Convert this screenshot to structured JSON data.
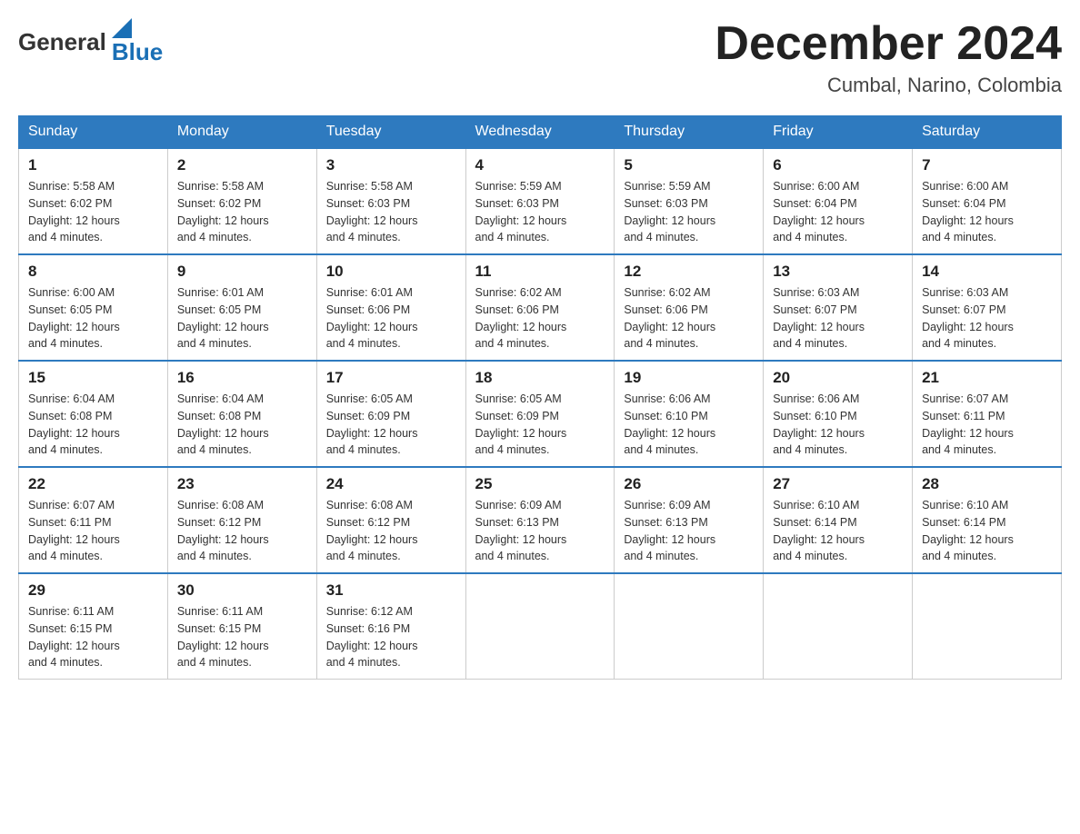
{
  "header": {
    "logo_general": "General",
    "logo_blue": "Blue",
    "month": "December 2024",
    "location": "Cumbal, Narino, Colombia"
  },
  "days_of_week": [
    "Sunday",
    "Monday",
    "Tuesday",
    "Wednesday",
    "Thursday",
    "Friday",
    "Saturday"
  ],
  "weeks": [
    [
      {
        "day": "1",
        "sunrise": "5:58 AM",
        "sunset": "6:02 PM",
        "daylight": "12 hours and 4 minutes."
      },
      {
        "day": "2",
        "sunrise": "5:58 AM",
        "sunset": "6:02 PM",
        "daylight": "12 hours and 4 minutes."
      },
      {
        "day": "3",
        "sunrise": "5:58 AM",
        "sunset": "6:03 PM",
        "daylight": "12 hours and 4 minutes."
      },
      {
        "day": "4",
        "sunrise": "5:59 AM",
        "sunset": "6:03 PM",
        "daylight": "12 hours and 4 minutes."
      },
      {
        "day": "5",
        "sunrise": "5:59 AM",
        "sunset": "6:03 PM",
        "daylight": "12 hours and 4 minutes."
      },
      {
        "day": "6",
        "sunrise": "6:00 AM",
        "sunset": "6:04 PM",
        "daylight": "12 hours and 4 minutes."
      },
      {
        "day": "7",
        "sunrise": "6:00 AM",
        "sunset": "6:04 PM",
        "daylight": "12 hours and 4 minutes."
      }
    ],
    [
      {
        "day": "8",
        "sunrise": "6:00 AM",
        "sunset": "6:05 PM",
        "daylight": "12 hours and 4 minutes."
      },
      {
        "day": "9",
        "sunrise": "6:01 AM",
        "sunset": "6:05 PM",
        "daylight": "12 hours and 4 minutes."
      },
      {
        "day": "10",
        "sunrise": "6:01 AM",
        "sunset": "6:06 PM",
        "daylight": "12 hours and 4 minutes."
      },
      {
        "day": "11",
        "sunrise": "6:02 AM",
        "sunset": "6:06 PM",
        "daylight": "12 hours and 4 minutes."
      },
      {
        "day": "12",
        "sunrise": "6:02 AM",
        "sunset": "6:06 PM",
        "daylight": "12 hours and 4 minutes."
      },
      {
        "day": "13",
        "sunrise": "6:03 AM",
        "sunset": "6:07 PM",
        "daylight": "12 hours and 4 minutes."
      },
      {
        "day": "14",
        "sunrise": "6:03 AM",
        "sunset": "6:07 PM",
        "daylight": "12 hours and 4 minutes."
      }
    ],
    [
      {
        "day": "15",
        "sunrise": "6:04 AM",
        "sunset": "6:08 PM",
        "daylight": "12 hours and 4 minutes."
      },
      {
        "day": "16",
        "sunrise": "6:04 AM",
        "sunset": "6:08 PM",
        "daylight": "12 hours and 4 minutes."
      },
      {
        "day": "17",
        "sunrise": "6:05 AM",
        "sunset": "6:09 PM",
        "daylight": "12 hours and 4 minutes."
      },
      {
        "day": "18",
        "sunrise": "6:05 AM",
        "sunset": "6:09 PM",
        "daylight": "12 hours and 4 minutes."
      },
      {
        "day": "19",
        "sunrise": "6:06 AM",
        "sunset": "6:10 PM",
        "daylight": "12 hours and 4 minutes."
      },
      {
        "day": "20",
        "sunrise": "6:06 AM",
        "sunset": "6:10 PM",
        "daylight": "12 hours and 4 minutes."
      },
      {
        "day": "21",
        "sunrise": "6:07 AM",
        "sunset": "6:11 PM",
        "daylight": "12 hours and 4 minutes."
      }
    ],
    [
      {
        "day": "22",
        "sunrise": "6:07 AM",
        "sunset": "6:11 PM",
        "daylight": "12 hours and 4 minutes."
      },
      {
        "day": "23",
        "sunrise": "6:08 AM",
        "sunset": "6:12 PM",
        "daylight": "12 hours and 4 minutes."
      },
      {
        "day": "24",
        "sunrise": "6:08 AM",
        "sunset": "6:12 PM",
        "daylight": "12 hours and 4 minutes."
      },
      {
        "day": "25",
        "sunrise": "6:09 AM",
        "sunset": "6:13 PM",
        "daylight": "12 hours and 4 minutes."
      },
      {
        "day": "26",
        "sunrise": "6:09 AM",
        "sunset": "6:13 PM",
        "daylight": "12 hours and 4 minutes."
      },
      {
        "day": "27",
        "sunrise": "6:10 AM",
        "sunset": "6:14 PM",
        "daylight": "12 hours and 4 minutes."
      },
      {
        "day": "28",
        "sunrise": "6:10 AM",
        "sunset": "6:14 PM",
        "daylight": "12 hours and 4 minutes."
      }
    ],
    [
      {
        "day": "29",
        "sunrise": "6:11 AM",
        "sunset": "6:15 PM",
        "daylight": "12 hours and 4 minutes."
      },
      {
        "day": "30",
        "sunrise": "6:11 AM",
        "sunset": "6:15 PM",
        "daylight": "12 hours and 4 minutes."
      },
      {
        "day": "31",
        "sunrise": "6:12 AM",
        "sunset": "6:16 PM",
        "daylight": "12 hours and 4 minutes."
      },
      null,
      null,
      null,
      null
    ]
  ],
  "labels": {
    "sunrise": "Sunrise:",
    "sunset": "Sunset:",
    "daylight": "Daylight: 12 hours"
  }
}
